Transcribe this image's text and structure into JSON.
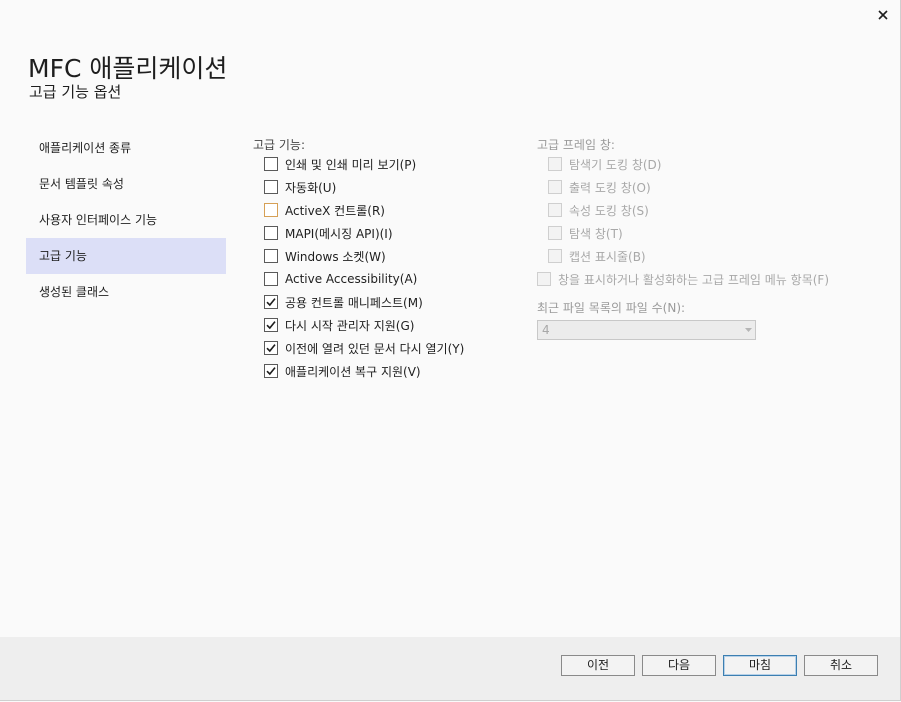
{
  "window": {
    "title": "MFC 애플리케이션",
    "subtitle": "고급 기능 옵션"
  },
  "sidebar": {
    "items": [
      {
        "label": "애플리케이션 종류",
        "selected": false
      },
      {
        "label": "문서 템플릿 속성",
        "selected": false
      },
      {
        "label": "사용자 인터페이스 기능",
        "selected": false
      },
      {
        "label": "고급 기능",
        "selected": true
      },
      {
        "label": "생성된 클래스",
        "selected": false
      }
    ]
  },
  "advanced": {
    "label": "고급 기능:",
    "options": [
      {
        "label": "인쇄 및 인쇄 미리 보기(P)",
        "checked": false
      },
      {
        "label": "자동화(U)",
        "checked": false
      },
      {
        "label": "ActiveX 컨트롤(R)",
        "checked": false
      },
      {
        "label": "MAPI(메시징 API)(I)",
        "checked": false
      },
      {
        "label": "Windows 소켓(W)",
        "checked": false
      },
      {
        "label": "Active Accessibility(A)",
        "checked": false
      },
      {
        "label": "공용 컨트롤 매니페스트(M)",
        "checked": true
      },
      {
        "label": "다시 시작 관리자 지원(G)",
        "checked": true
      },
      {
        "label": "이전에 열려 있던 문서 다시 열기(Y)",
        "checked": true
      },
      {
        "label": "애플리케이션 복구 지원(V)",
        "checked": true
      }
    ]
  },
  "frame_panes": {
    "label": "고급 프레임 창:",
    "options": [
      {
        "label": "탐색기 도킹 창(D)",
        "checked": false
      },
      {
        "label": "출력 도킹 창(O)",
        "checked": false
      },
      {
        "label": "속성 도킹 창(S)",
        "checked": false
      },
      {
        "label": "탐색 창(T)",
        "checked": false
      },
      {
        "label": "캡션 표시줄(B)",
        "checked": false
      }
    ],
    "menu_option": {
      "label": "창을 표시하거나 활성화하는 고급 프레임 메뉴 항목(F)",
      "checked": false
    }
  },
  "recent_files": {
    "label": "최근 파일 목록의 파일 수(N):",
    "value": "4"
  },
  "footer": {
    "back_label": "이전",
    "next_label": "다음",
    "finish_label": "마침",
    "cancel_label": "취소"
  },
  "colors": {
    "selected_nav": "#dcdff7",
    "primary_border": "#3c7fb1"
  }
}
